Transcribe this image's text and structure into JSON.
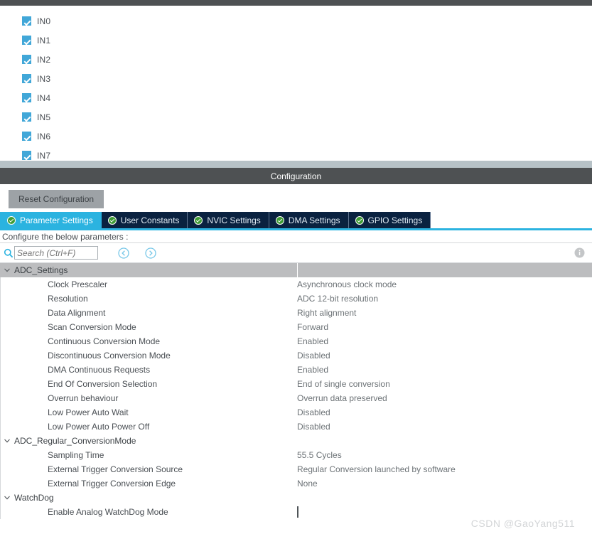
{
  "window": {
    "config_section_title": "Configuration",
    "watermark": "CSDN @GaoYang511"
  },
  "channel_panel": {
    "channels": [
      {
        "label": "IN0",
        "checked": true
      },
      {
        "label": "IN1",
        "checked": true
      },
      {
        "label": "IN2",
        "checked": true
      },
      {
        "label": "IN3",
        "checked": true
      },
      {
        "label": "IN4",
        "checked": true
      },
      {
        "label": "IN5",
        "checked": true
      },
      {
        "label": "IN6",
        "checked": true
      },
      {
        "label": "IN7",
        "checked": true
      }
    ]
  },
  "toolbar": {
    "reset_label": "Reset Configuration"
  },
  "tabs": [
    {
      "label": "Parameter Settings",
      "active": true,
      "icon": "green-check-icon"
    },
    {
      "label": "User Constants",
      "active": false,
      "icon": "green-check-icon"
    },
    {
      "label": "NVIC Settings",
      "active": false,
      "icon": "green-check-icon"
    },
    {
      "label": "DMA Settings",
      "active": false,
      "icon": "green-check-icon"
    },
    {
      "label": "GPIO Settings",
      "active": false,
      "icon": "green-check-icon"
    }
  ],
  "panel": {
    "hint": "Configure the below parameters :",
    "search": {
      "placeholder": "Search (Ctrl+F)",
      "value": "",
      "icon": "search-icon",
      "prev_icon": "chevron-left-circle-icon",
      "next_icon": "chevron-right-circle-icon"
    },
    "info_icon": "info-circle-icon"
  },
  "colors": {
    "accent": "#2bb3e0",
    "tab_bar": "#0a2240",
    "title_bar": "#4e5153",
    "selected_row": "#bcbdbf",
    "checkbox_on": "#41a7d8",
    "separator_band": "#b7c2c7",
    "reset_button": "#9da2a6",
    "check_badge": "#3f9c35"
  },
  "tree": [
    {
      "type": "group",
      "label": "ADC_Settings",
      "expanded": true,
      "selected": true,
      "rows": [
        {
          "name": "Clock Prescaler",
          "value": "Asynchronous clock mode"
        },
        {
          "name": "Resolution",
          "value": "ADC 12-bit resolution"
        },
        {
          "name": "Data Alignment",
          "value": "Right alignment"
        },
        {
          "name": "Scan Conversion Mode",
          "value": "Forward"
        },
        {
          "name": "Continuous Conversion Mode",
          "value": "Enabled"
        },
        {
          "name": "Discontinuous Conversion Mode",
          "value": "Disabled"
        },
        {
          "name": "DMA Continuous Requests",
          "value": "Enabled"
        },
        {
          "name": "End Of Conversion Selection",
          "value": "End of single conversion"
        },
        {
          "name": "Overrun behaviour",
          "value": "Overrun data preserved"
        },
        {
          "name": "Low Power Auto Wait",
          "value": "Disabled"
        },
        {
          "name": "Low Power Auto Power Off",
          "value": "Disabled"
        }
      ]
    },
    {
      "type": "group",
      "label": "ADC_Regular_ConversionMode",
      "expanded": true,
      "selected": false,
      "rows": [
        {
          "name": "Sampling Time",
          "value": "55.5 Cycles"
        },
        {
          "name": "External Trigger Conversion Source",
          "value": "Regular Conversion launched by software"
        },
        {
          "name": "External Trigger Conversion Edge",
          "value": "None"
        }
      ]
    },
    {
      "type": "group",
      "label": "WatchDog",
      "expanded": true,
      "selected": false,
      "rows": [
        {
          "name": "Enable Analog WatchDog Mode",
          "value": "",
          "control": "checkbox",
          "checked": false
        }
      ]
    }
  ]
}
